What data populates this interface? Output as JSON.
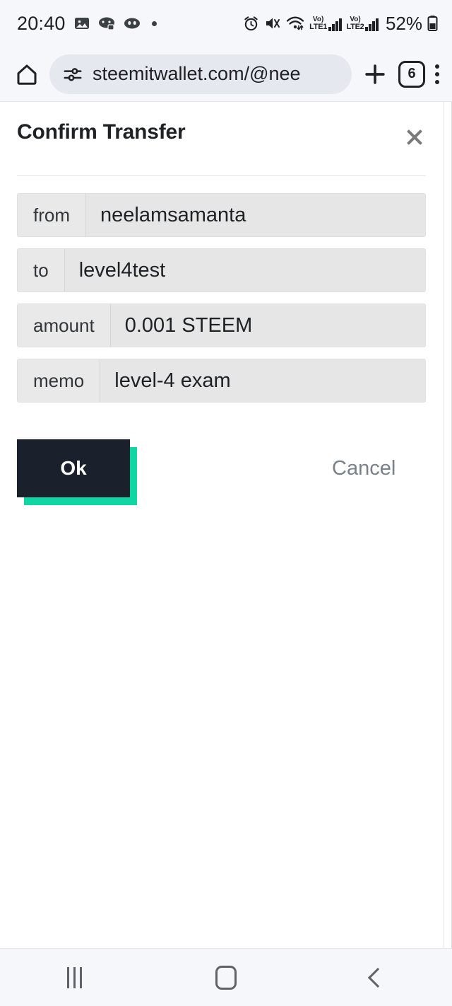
{
  "status_bar": {
    "time": "20:40",
    "left_icons": [
      "gallery-icon",
      "game-controller-icon",
      "discord-icon",
      "dot-indicator"
    ],
    "alarm_icon": "alarm-icon",
    "mute_icon": "volume-mute-icon",
    "wifi_icon": "wifi-icon",
    "sim1": {
      "volte": "Vo)",
      "network": "LTE1",
      "bars": 4
    },
    "sim2": {
      "volte": "Vo)",
      "network": "LTE2",
      "bars": 4
    },
    "battery_percent": "52%"
  },
  "browser": {
    "home_icon": "home-icon",
    "page_info_icon": "page-info-tune-icon",
    "url": "steemitwallet.com/@nee",
    "new_tab_icon": "plus-icon",
    "tab_count": "6",
    "menu_icon": "more-vertical-icon"
  },
  "dialog": {
    "title": "Confirm Transfer",
    "close_icon": "close-icon",
    "fields": [
      {
        "label": "from",
        "value": "neelamsamanta"
      },
      {
        "label": "to",
        "value": "level4test"
      },
      {
        "label": "amount",
        "value": "0.001 STEEM"
      },
      {
        "label": "memo",
        "value": "level-4 exam"
      }
    ],
    "confirm_label": "Ok",
    "cancel_label": "Cancel",
    "accent_color": "#0fd6a3",
    "confirm_bg": "#1a202c"
  },
  "nav_bar": {
    "recents": "recents-icon",
    "home": "home-square-icon",
    "back": "back-chevron-icon"
  }
}
